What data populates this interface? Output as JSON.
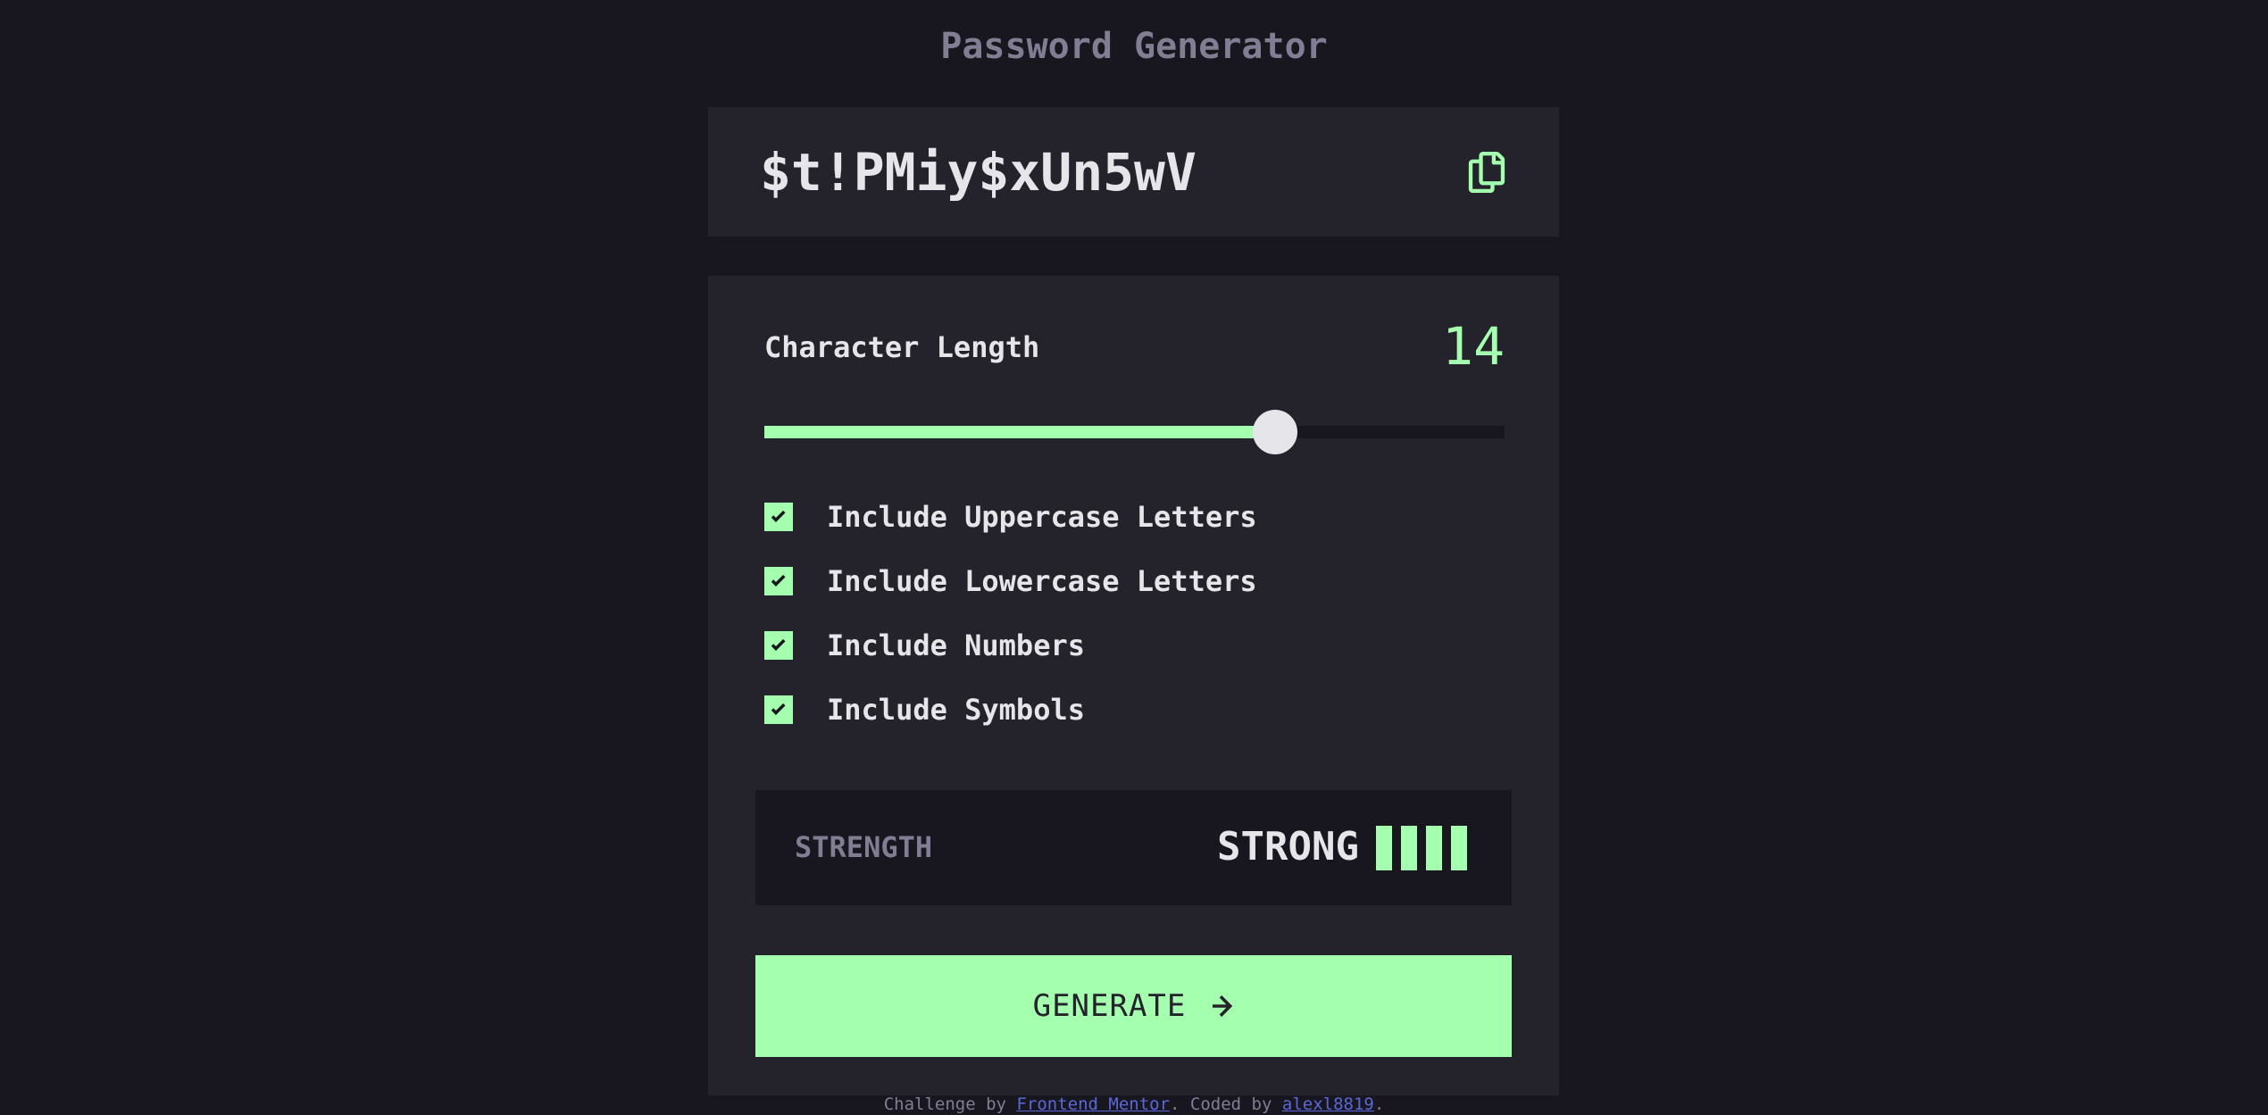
{
  "app": {
    "title": "Password Generator"
  },
  "password": {
    "value": "$t!PMiy$xUn5wV",
    "copy_icon": "copy-icon"
  },
  "length": {
    "label": "Character Length",
    "value": "14",
    "fill_fraction": 0.69
  },
  "options": [
    {
      "label": "Include Uppercase Letters",
      "checked": true
    },
    {
      "label": "Include Lowercase Letters",
      "checked": true
    },
    {
      "label": "Include Numbers",
      "checked": true
    },
    {
      "label": "Include Symbols",
      "checked": true
    }
  ],
  "strength": {
    "label": "STRENGTH",
    "value": "STRONG",
    "bars_filled": 4,
    "bars_total": 4
  },
  "generate": {
    "label": "GENERATE",
    "icon": "arrow-right-icon"
  },
  "footer": {
    "prefix": "Challenge by ",
    "link1": "Frontend Mentor",
    "middle": ". Coded by ",
    "link2": "alexl8819",
    "suffix": "."
  },
  "colors": {
    "background": "#18171f",
    "panel": "#24232c",
    "accent": "#a4ffaf",
    "text": "#e6e5ea",
    "muted": "#817d92",
    "link": "#5a67d8"
  }
}
